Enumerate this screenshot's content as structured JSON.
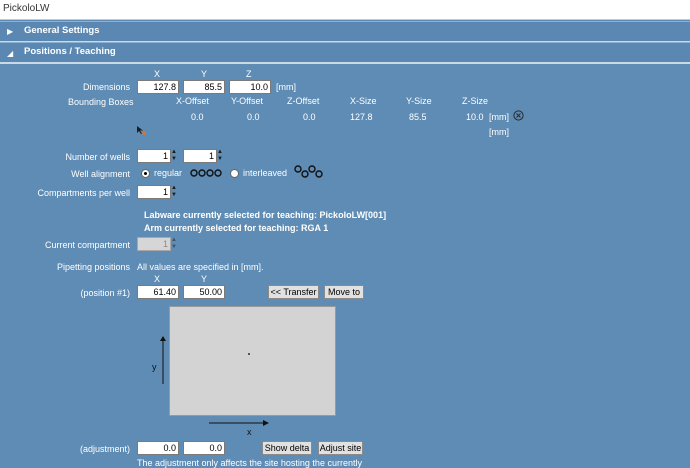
{
  "window": {
    "title": "PickoloLW"
  },
  "sections": {
    "general": "General Settings",
    "positions": "Positions / Teaching"
  },
  "dimensions": {
    "label": "Dimensions",
    "col_x": "X",
    "col_y": "Y",
    "col_z": "Z",
    "x": "127.8",
    "y": "85.5",
    "z": "10.0",
    "unit": "[mm]"
  },
  "bounding": {
    "label": "Bounding Boxes",
    "headers": [
      "X-Offset",
      "Y-Offset",
      "Z-Offset",
      "X-Size",
      "Y-Size",
      "Z-Size"
    ],
    "values": [
      "0.0",
      "0.0",
      "0.0",
      "127.8",
      "85.5",
      "10.0"
    ],
    "unit": "[mm]",
    "unit2": "[mm]"
  },
  "wells": {
    "label": "Number of wells",
    "a": "1",
    "b": "1"
  },
  "alignment": {
    "label": "Well alignment",
    "regular": "regular",
    "interleaved": "interleaved",
    "selected": "regular"
  },
  "compartments": {
    "label": "Compartments per well",
    "value": "1"
  },
  "teaching": {
    "labware": "Labware currently selected for teaching: PickoloLW[001]",
    "arm": "Arm currently selected for teaching: RGA 1"
  },
  "current_compartment": {
    "label": "Current compartment",
    "value": "1"
  },
  "pipetting": {
    "label": "Pipetting positions",
    "note": "All values are specified in [mm].",
    "col_x": "X",
    "col_y": "Y",
    "position_label": "(position #1)",
    "x": "61.40",
    "y": "50.00",
    "transfer": "<< Transfer",
    "move_to": "Move to"
  },
  "plot": {
    "x_axis": "x",
    "y_axis": "y"
  },
  "adjustment": {
    "label": "(adjustment)",
    "x": "0.0",
    "y": "0.0",
    "show_delta": "Show delta",
    "adjust_site": "Adjust site",
    "note": "The adjustment only affects the site hosting the currently"
  },
  "icons": {
    "section_collapsed": "triangle-right-icon",
    "section_expanded": "triangle-down-icon",
    "clear": "close-circle-icon",
    "add": "add-cursor-icon"
  },
  "colors": {
    "background": "#5f8cb4",
    "band": "#5a88b2",
    "plot_area": "#d3d3d3"
  }
}
